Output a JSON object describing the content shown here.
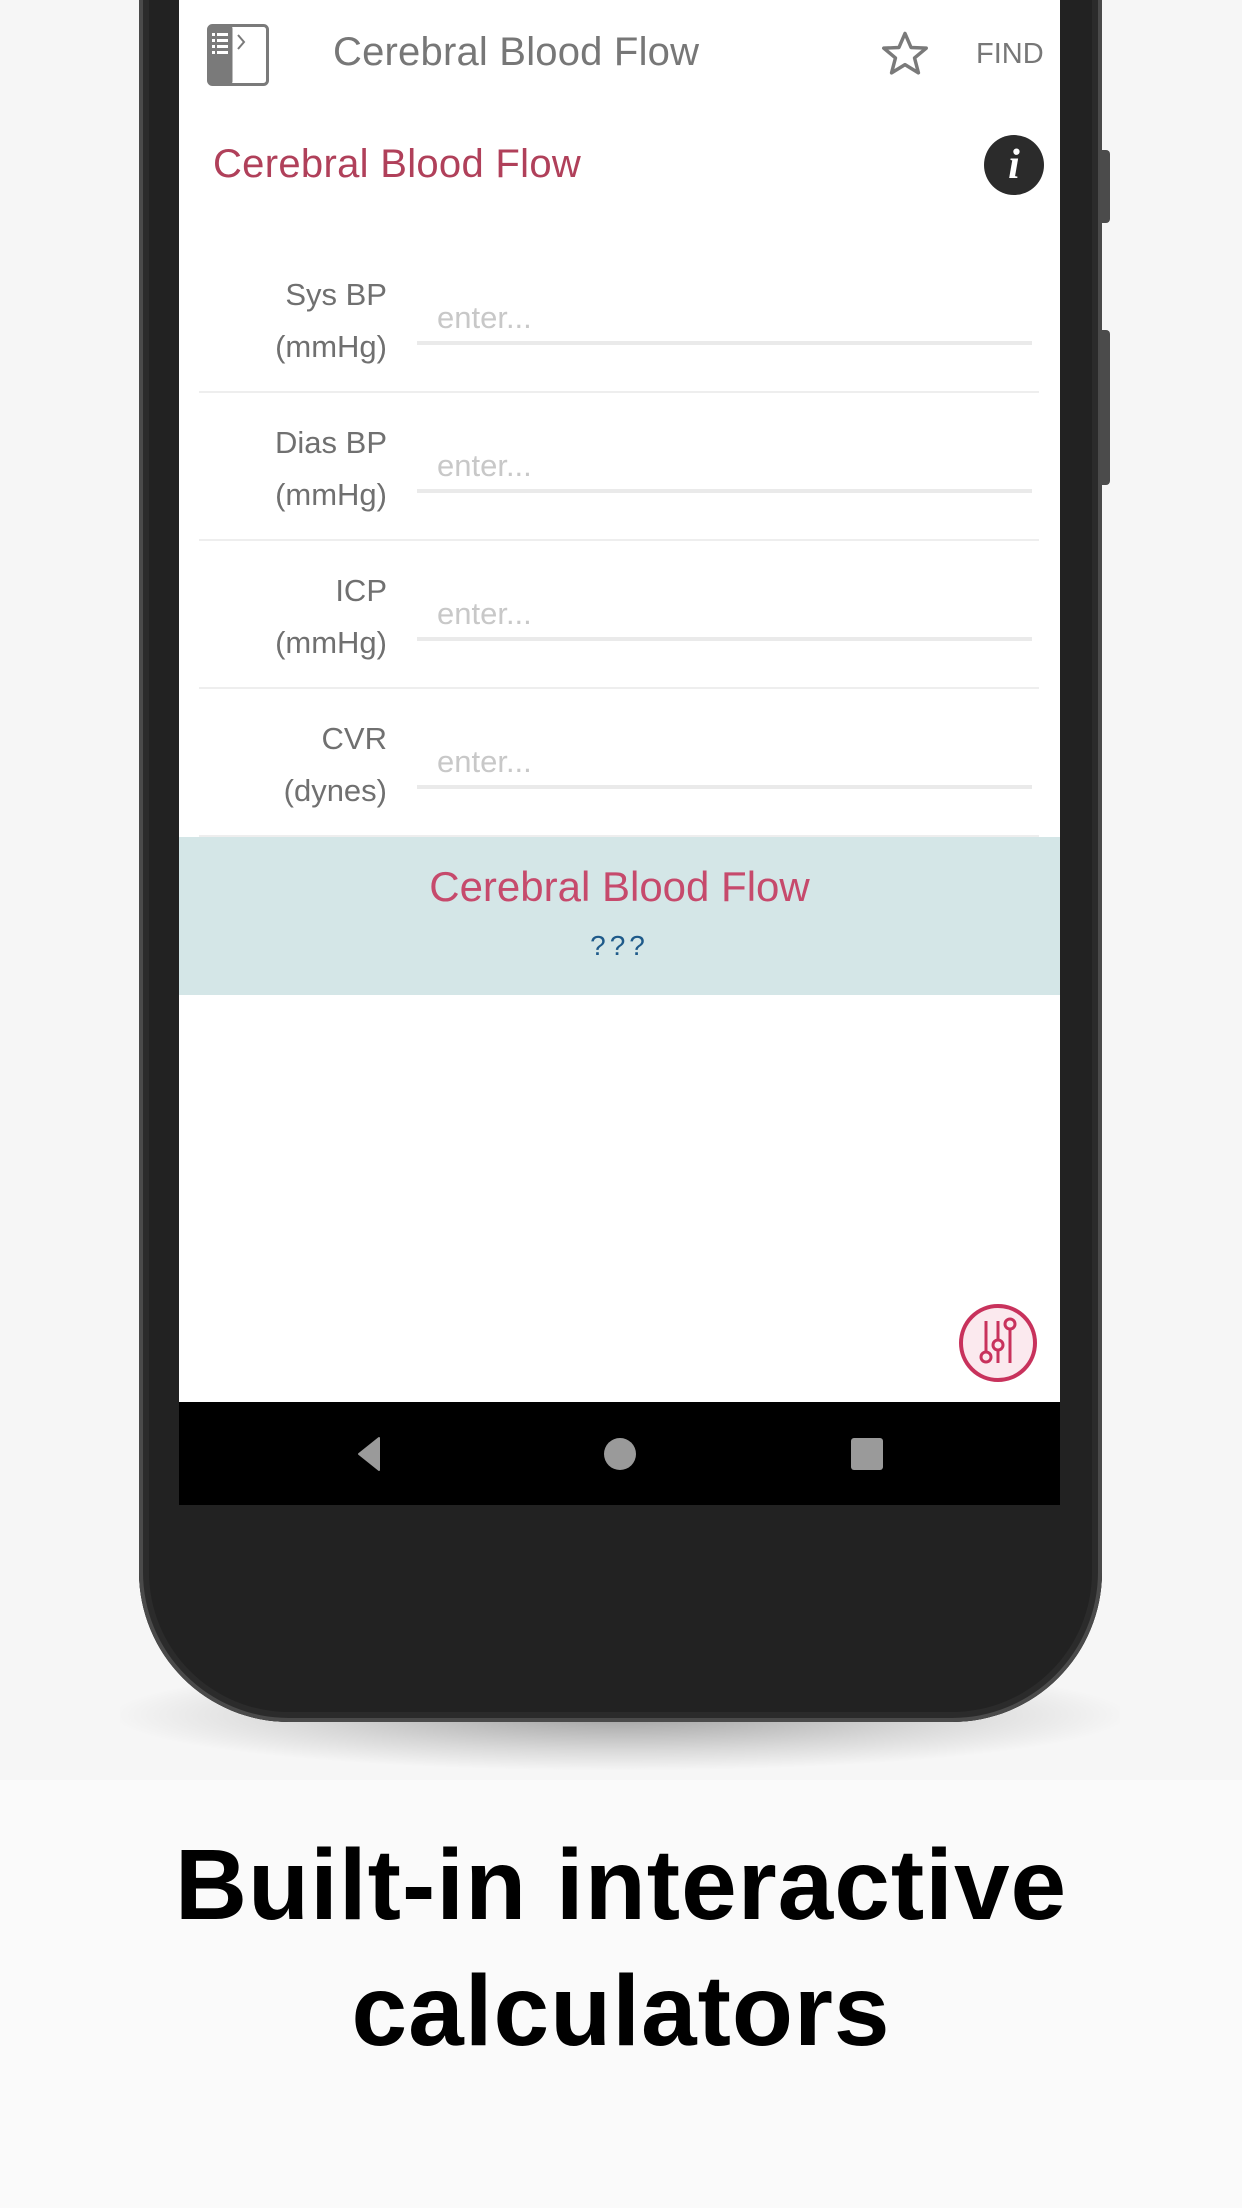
{
  "toolbar": {
    "menu_icon": "drawer-toggle-icon",
    "title": "Cerebral Blood Flow",
    "favorite_icon": "star-outline-icon",
    "find_label": "FIND"
  },
  "calculator": {
    "title": "Cerebral Blood Flow",
    "info_icon": "info-icon",
    "info_glyph": "i",
    "fields": [
      {
        "label_line1": "Sys BP",
        "label_line2": "(mmHg)",
        "value": "",
        "placeholder": "enter..."
      },
      {
        "label_line1": "Dias BP",
        "label_line2": "(mmHg)",
        "value": "",
        "placeholder": "enter..."
      },
      {
        "label_line1": "ICP",
        "label_line2": "(mmHg)",
        "value": "",
        "placeholder": "enter..."
      },
      {
        "label_line1": "CVR",
        "label_line2": "(dynes)",
        "value": "",
        "placeholder": "enter..."
      }
    ],
    "result": {
      "label": "Cerebral Blood Flow",
      "value": "???"
    },
    "fab_icon": "sliders-icon"
  },
  "navbar": {
    "back_icon": "nav-back-icon",
    "home_icon": "nav-home-icon",
    "recents_icon": "nav-recents-icon"
  },
  "colors": {
    "accent": "#c64a6c",
    "result_bg": "#d4e6e7",
    "result_value": "#1e5a8a",
    "title_gray": "#777777"
  },
  "caption": {
    "line1": "Built-in interactive",
    "line2": "calculators"
  }
}
